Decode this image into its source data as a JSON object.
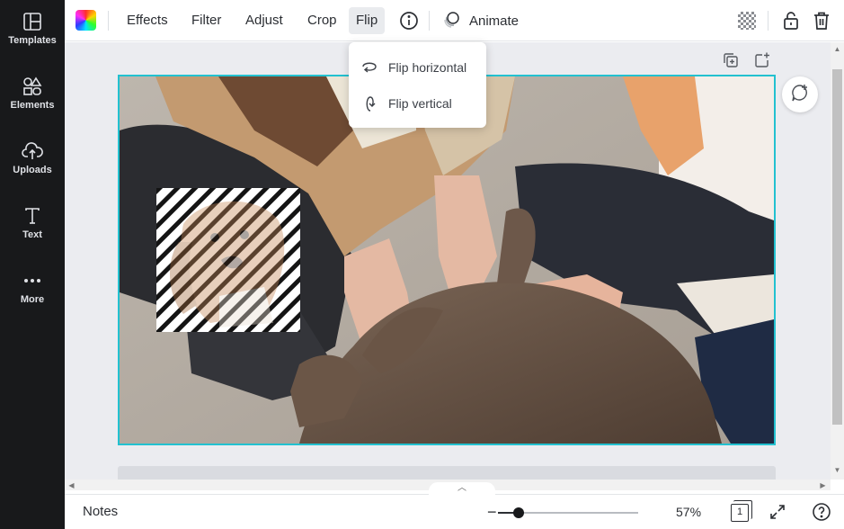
{
  "sidebar": {
    "items": [
      {
        "label": "Templates",
        "icon": "templates-icon"
      },
      {
        "label": "Elements",
        "icon": "elements-icon"
      },
      {
        "label": "Uploads",
        "icon": "uploads-icon"
      },
      {
        "label": "Text",
        "icon": "text-icon"
      },
      {
        "label": "More",
        "icon": "more-icon"
      }
    ]
  },
  "toolbar": {
    "effects": "Effects",
    "filter": "Filter",
    "adjust": "Adjust",
    "crop": "Crop",
    "flip": "Flip",
    "animate": "Animate"
  },
  "flip_menu": {
    "items": [
      {
        "label": "Flip horizontal",
        "icon": "flip-horizontal-icon"
      },
      {
        "label": "Flip vertical",
        "icon": "flip-vertical-icon"
      }
    ]
  },
  "bottom": {
    "notes": "Notes",
    "zoom": "57%",
    "zoom_fraction": 0.15,
    "page_count": "1"
  },
  "colors": {
    "sidebar_bg": "#18191b",
    "selection": "#22c1d0",
    "canvas_bg": "#ebecf0"
  }
}
